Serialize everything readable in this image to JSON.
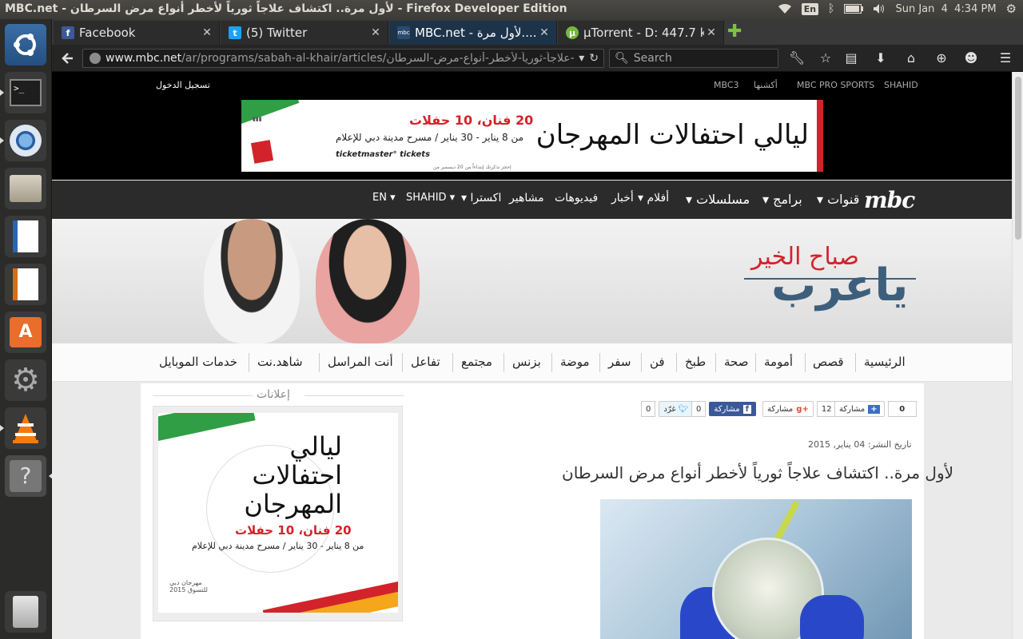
{
  "os": {
    "window_title": "MBC.net - لأول مرة.. اكتشاف علاجاً ثورياً لأخطر أنواع مرض السرطان - Firefox Developer Edition",
    "keyboard_layout": "En",
    "clock": "Sun Jan  4  4:34 PM"
  },
  "launcher": {
    "apps": [
      "ubuntu-dash",
      "terminal",
      "chromium",
      "file-manager",
      "libreoffice-writer",
      "libreoffice-impress",
      "software-center",
      "system-settings",
      "vlc",
      "help",
      "trash"
    ]
  },
  "browser": {
    "tabs": [
      {
        "label": "Facebook",
        "icon": "facebook-icon",
        "active": false
      },
      {
        "label": "(5) Twitter",
        "icon": "twitter-icon",
        "active": false
      },
      {
        "label": "MBC.net - لأول مرة.....",
        "icon": "mbc-icon",
        "active": true
      },
      {
        "label": "µTorrent - D: 447.7 k...",
        "icon": "utorrent-icon",
        "active": false
      }
    ],
    "new_tab_label": "✚",
    "url_host": "www.mbc.net",
    "url_path": "/ar/programs/sabah-al-khair/articles/لأول-مرة-اكتشاف-علاجاً-ثورياً-لأخطر-أنواع-مرض-السرطان/",
    "search_placeholder": "Search"
  },
  "page": {
    "top_links": [
      "SHAHID",
      "MBC PRO SPORTS",
      "أكشنها",
      "MBC3"
    ],
    "login": "تسجيل الدخول",
    "banner": {
      "headline": "ليالي احتفالات المهرجان",
      "sub1": "20 فنان، 10 حفلات",
      "sub2": "من 8 يناير - 30 يناير  /  مسرح مدينة دبي للإعلام",
      "tickets": "ticketmaster°   tickets",
      "small": "إحجز تذكرتك إبتداءاً من 20 ديسمبر من"
    },
    "main_nav": {
      "logo": "mbc",
      "items": [
        "قنوات ▾",
        "برامج ▾",
        "مسلسلات ▾",
        "أفلام ▾",
        "أخبار",
        "فيديوهات",
        "مشاهير",
        "اكسترا ▾",
        "SHAHID ▾",
        "EN ▾"
      ]
    },
    "hero": {
      "brand_line1": "صباح الخير",
      "brand_line2": "ياعرب"
    },
    "sub_nav": [
      "الرئيسية",
      "قصص",
      "أمومة",
      "صحة",
      "طبخ",
      "فن",
      "سفر",
      "موضة",
      "بزنس",
      "مجتمع",
      "تفاعل",
      "أنت المراسل",
      "شاهد.نت",
      "خدمات الموبايل"
    ],
    "sidebar": {
      "ads_label": "إعلانات",
      "ad": {
        "headline": "ليالي احتفالات المهرجان",
        "sub1": "20 فنان، 10 حفلات",
        "sub2": "من 8 يناير - 30 يناير  /  مسرح مدينة دبي للإعلام",
        "brand": "مهرجان دبي للتسوق 2015"
      }
    },
    "article": {
      "share": {
        "total_count": "0",
        "share_label": "مشاركة",
        "gplus_count": "12",
        "gplus_label": "مشاركة",
        "fb_count": "0",
        "fb_label": "مشاركة",
        "tw_label": "غرّد",
        "tw_count": "0"
      },
      "published": "تاريخ النشر: 04 يناير, 2015",
      "title": "لأول مرة.. اكتشاف علاجاً ثورياً لأخطر أنواع مرض السرطان"
    }
  }
}
